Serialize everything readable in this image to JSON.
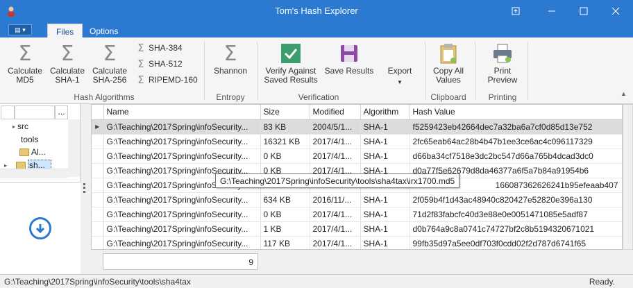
{
  "window": {
    "title": "Tom's Hash Explorer"
  },
  "tabs": [
    {
      "label": "Files"
    },
    {
      "label": "Options"
    }
  ],
  "ribbon": {
    "hash_algorithms": {
      "calc_md5": "Calculate\nMD5",
      "calc_sha1": "Calculate\nSHA-1",
      "calc_sha256": "Calculate\nSHA-256",
      "sha384": "SHA-384",
      "sha512": "SHA-512",
      "ripemd160": "RIPEMD-160",
      "group_label": "Hash Algorithms"
    },
    "entropy": {
      "shannon": "Shannon",
      "group_label": "Entropy"
    },
    "verification": {
      "verify": "Verify Against\nSaved Results",
      "save": "Save Results",
      "export": "Export",
      "group_label": "Verification"
    },
    "clipboard": {
      "copy_all": "Copy All\nValues",
      "group_label": "Clipboard"
    },
    "printing": {
      "print_preview": "Print\nPreview",
      "group_label": "Printing"
    }
  },
  "tree": {
    "header_button": "...",
    "items": [
      {
        "label": "src"
      },
      {
        "label": "tools"
      },
      {
        "label": "Al..."
      },
      {
        "label": "sh..."
      }
    ]
  },
  "grid": {
    "columns": [
      "Name",
      "Size",
      "Modified",
      "Algorithm",
      "Hash Value"
    ],
    "rows": [
      {
        "name": "G:\\Teaching\\2017Spring\\infoSecurity...",
        "size": "83 KB",
        "modified": "2004/5/1...",
        "algorithm": "SHA-1",
        "hash": "f5259423eb42664dec7a32ba6a7cf0d85d13e752",
        "selected": true
      },
      {
        "name": "G:\\Teaching\\2017Spring\\infoSecurity...",
        "size": "16321 KB",
        "modified": "2017/4/1...",
        "algorithm": "SHA-1",
        "hash": "2fc65eab64ac28b4b47b1ee3ce6ac4c096117329",
        "selected": false
      },
      {
        "name": "G:\\Teaching\\2017Spring\\infoSecurity...",
        "size": "0 KB",
        "modified": "2017/4/1...",
        "algorithm": "SHA-1",
        "hash": "d66ba34cf7518e3dc2bc547d66a765b4dcad3dc0",
        "selected": false
      },
      {
        "name": "G:\\Teaching\\2017Spring\\infoSecurity...",
        "size": "0 KB",
        "modified": "2017/4/1...",
        "algorithm": "SHA-1",
        "hash": "d0a77f5e62679d8da46377a6f5a7b84a91954b6",
        "selected": false
      },
      {
        "name": "G:\\Teaching\\2017Spring\\infoSecurity...",
        "size": "",
        "modified": "",
        "algorithm": "SHA-1",
        "hash": "166087362626241b95efeaab407",
        "selected": false
      },
      {
        "name": "G:\\Teaching\\2017Spring\\infoSecurity...",
        "size": "634 KB",
        "modified": "2016/11/...",
        "algorithm": "SHA-1",
        "hash": "2f059b4f1d43ac48940c820427e52820e396a130",
        "selected": false
      },
      {
        "name": "G:\\Teaching\\2017Spring\\infoSecurity...",
        "size": "0 KB",
        "modified": "2017/4/1...",
        "algorithm": "SHA-1",
        "hash": "71d2f83fabcfc40d3e88e0e0051471085e5adf87",
        "selected": false
      },
      {
        "name": "G:\\Teaching\\2017Spring\\infoSecurity...",
        "size": "1 KB",
        "modified": "2017/4/1...",
        "algorithm": "SHA-1",
        "hash": "d0b764a9c8a0741c74727bf2c8b5194320671021",
        "selected": false
      },
      {
        "name": "G:\\Teaching\\2017Spring\\infoSecurity...",
        "size": "117 KB",
        "modified": "2017/4/1...",
        "algorithm": "SHA-1",
        "hash": "99fb35d97a5ee0df703f0cdd02f2d787d6741f65",
        "selected": false
      }
    ]
  },
  "tooltip": "G:\\Teaching\\2017Spring\\infoSecurity\\tools\\sha4tax\\irx1700.md5",
  "count": "9",
  "status": {
    "path": "G:\\Teaching\\2017Spring\\infoSecurity\\tools\\sha4tax",
    "state": "Ready."
  },
  "colors": {
    "titlebar": "#2b79d0",
    "selected_row": "#dcdcdc"
  },
  "icons": [
    "user-icon",
    "restore-icon",
    "minimize-icon",
    "maximize-icon",
    "close-icon",
    "sigma-icon",
    "checkmark-icon",
    "save-icon",
    "clipboard-icon",
    "printer-icon",
    "folder-icon",
    "arrow-down-circle-icon"
  ]
}
